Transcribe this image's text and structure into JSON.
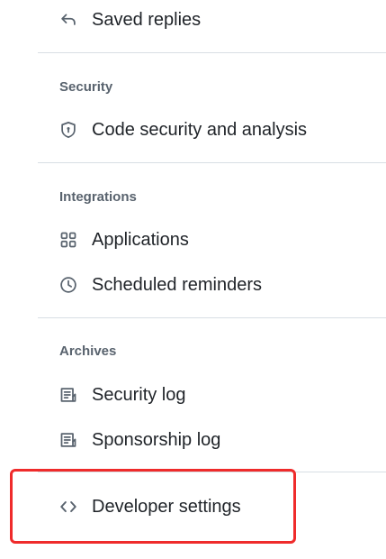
{
  "nav": {
    "saved_replies": {
      "label": "Saved replies",
      "icon": "reply-icon"
    },
    "security": {
      "heading": "Security",
      "items": [
        {
          "label": "Code security and analysis",
          "icon": "shield-lock-icon"
        }
      ]
    },
    "integrations": {
      "heading": "Integrations",
      "items": [
        {
          "label": "Applications",
          "icon": "apps-icon"
        },
        {
          "label": "Scheduled reminders",
          "icon": "clock-icon"
        }
      ]
    },
    "archives": {
      "heading": "Archives",
      "items": [
        {
          "label": "Security log",
          "icon": "log-icon"
        },
        {
          "label": "Sponsorship log",
          "icon": "log-icon"
        }
      ]
    },
    "developer_settings": {
      "label": "Developer settings",
      "icon": "code-icon"
    }
  },
  "highlight_color": "#ef2b2b"
}
